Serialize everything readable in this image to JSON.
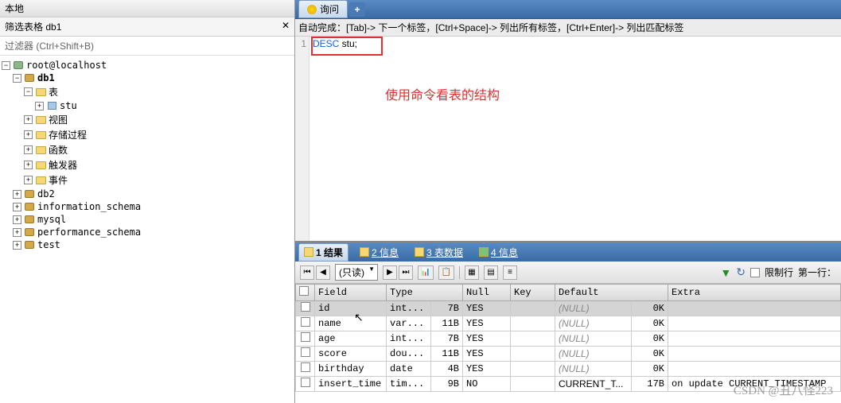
{
  "left": {
    "title": "本地",
    "filter_label": "筛选表格",
    "filter_db": "db1",
    "filter_hint": "过滤器 (Ctrl+Shift+B)",
    "tree": {
      "root": "root@localhost",
      "db1": "db1",
      "tables": "表",
      "stu": "stu",
      "views": "视图",
      "procedures": "存储过程",
      "functions": "函数",
      "triggers": "触发器",
      "events": "事件",
      "db2": "db2",
      "info_schema": "information_schema",
      "mysql": "mysql",
      "perf_schema": "performance_schema",
      "test": "test"
    }
  },
  "editor": {
    "tab_query": "询问",
    "tab_add": "+",
    "hint": "自动完成：[Tab]-> 下一个标签，[Ctrl+Space]-> 列出所有标签，[Ctrl+Enter]-> 列出匹配标签",
    "line_no": "1",
    "code_kw": "DESC",
    "code_rest": " stu;",
    "annotation": "使用命令看表的结构"
  },
  "results": {
    "tabs": {
      "result": "1 结果",
      "info": "2 信息",
      "tabledata": "3 表数据",
      "dbinfo": "4 信息"
    },
    "toolbar": {
      "mode": "(只读)",
      "limit_label": "限制行",
      "firstrow_label": "第一行："
    },
    "headers": {
      "field": "Field",
      "type": "Type",
      "null": "Null",
      "key": "Key",
      "default": "Default",
      "extra": "Extra"
    },
    "rows": [
      {
        "field": "id",
        "type": "int...",
        "size": "7B",
        "null": "YES",
        "key": "",
        "default": "(NULL)",
        "dsize": "0K",
        "extra": ""
      },
      {
        "field": "name",
        "type": "var...",
        "size": "11B",
        "null": "YES",
        "key": "",
        "default": "(NULL)",
        "dsize": "0K",
        "extra": ""
      },
      {
        "field": "age",
        "type": "int...",
        "size": "7B",
        "null": "YES",
        "key": "",
        "default": "(NULL)",
        "dsize": "0K",
        "extra": ""
      },
      {
        "field": "score",
        "type": "dou...",
        "size": "11B",
        "null": "YES",
        "key": "",
        "default": "(NULL)",
        "dsize": "0K",
        "extra": ""
      },
      {
        "field": "birthday",
        "type": "date",
        "size": "4B",
        "null": "YES",
        "key": "",
        "default": "(NULL)",
        "dsize": "0K",
        "extra": ""
      },
      {
        "field": "insert_time",
        "type": "tim...",
        "size": "9B",
        "null": "NO",
        "key": "",
        "default": "CURRENT_T...",
        "dsize": "17B",
        "extra": "on update CURRENT_TIMESTAMP"
      }
    ]
  },
  "watermark": "CSDN @丑八怪223"
}
